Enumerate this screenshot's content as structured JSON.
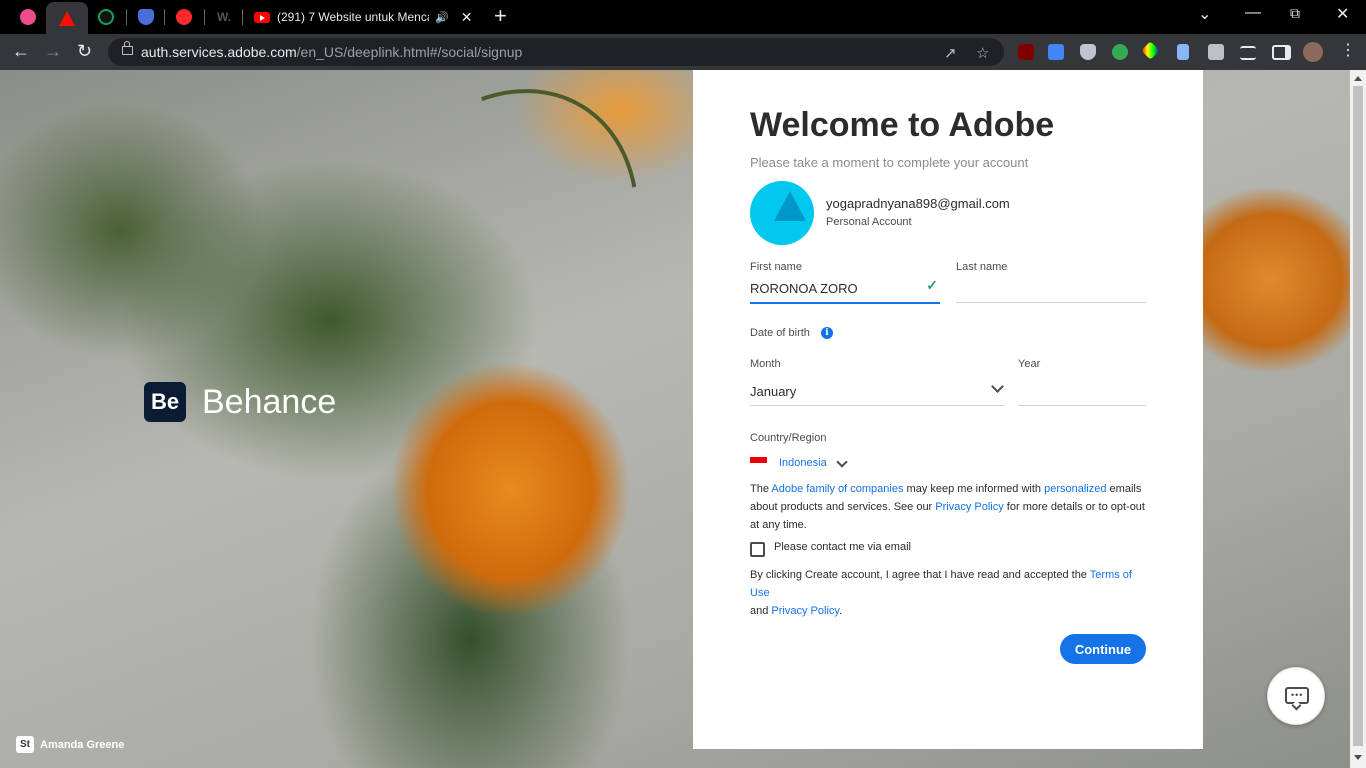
{
  "browser": {
    "tabs": [
      {
        "name": "dribbble-tab",
        "color": "#ea4c89"
      },
      {
        "name": "adobe-tab",
        "color": "#fa0f00"
      },
      {
        "name": "green-tab",
        "color": "#1a9f5a"
      },
      {
        "name": "shield-tab",
        "color": "#4a6fd6"
      },
      {
        "name": "red-tab",
        "color": "#ff2b2b"
      },
      {
        "name": "w-tab",
        "color": "#555555"
      }
    ],
    "active_tab_title": "(291) 7 Website untuk Menca",
    "url_host": "auth.services.adobe.com",
    "url_path": "/en_US/deeplink.html#/social/signup"
  },
  "background": {
    "brand": "Behance",
    "brand_logo": "Be",
    "credit_logo": "St",
    "credit": "Amanda Greene"
  },
  "form": {
    "title": "Welcome to Adobe",
    "subtitle": "Please take a moment to complete your account",
    "email": "yogapradnyana898@gmail.com",
    "account_type": "Personal Account",
    "first_name_label": "First name",
    "first_name_value": "RORONOA ZORO",
    "last_name_label": "Last name",
    "last_name_value": "",
    "dob_label": "Date of birth",
    "month_label": "Month",
    "month_value": "January",
    "year_label": "Year",
    "year_value": "",
    "country_label": "Country/Region",
    "country_value": "Indonesia",
    "consent_pre": "The ",
    "consent_link1": "Adobe family of companies",
    "consent_mid1": " may keep me informed with ",
    "consent_link2": "personalized",
    "consent_mid2": " emails about products and services. See our ",
    "consent_link3": "Privacy Policy",
    "consent_post": " for more details or to opt-out at any time.",
    "contact_label": "Please contact me via email",
    "terms_pre": "By clicking Create account, I agree that I have read and accepted the ",
    "terms_link": "Terms of Use",
    "terms_mid": " and ",
    "terms_link2": "Privacy Policy",
    "terms_post": ".",
    "continue_label": "Continue"
  },
  "colors": {
    "accent": "#1473e6",
    "check": "#2d9d78"
  }
}
